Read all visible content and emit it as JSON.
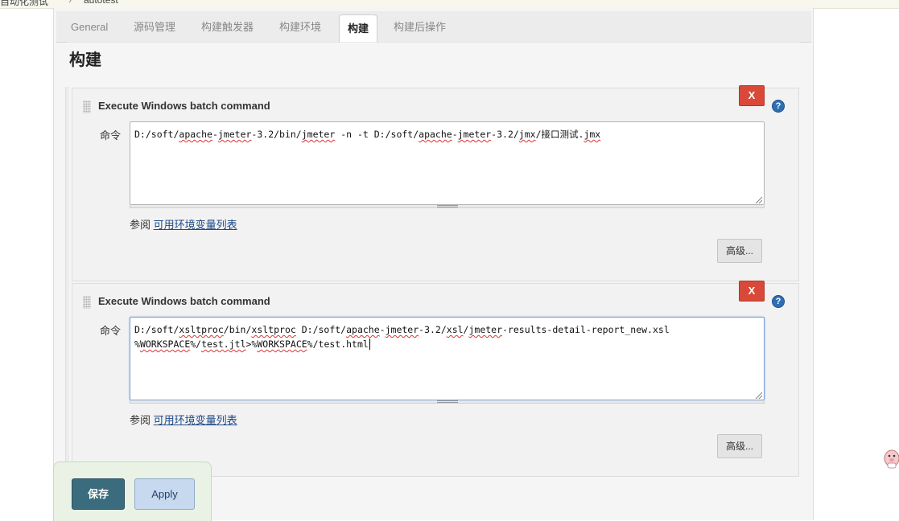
{
  "breadcrumb": {
    "items": [
      "自动化测试",
      "autotest"
    ]
  },
  "tabs": [
    {
      "label": "General",
      "active": false
    },
    {
      "label": "源码管理",
      "active": false
    },
    {
      "label": "构建触发器",
      "active": false
    },
    {
      "label": "构建环境",
      "active": false
    },
    {
      "label": "构建",
      "active": true
    },
    {
      "label": "构建后操作",
      "active": false
    }
  ],
  "section": {
    "title": "构建"
  },
  "steps": [
    {
      "title": "Execute Windows batch command",
      "delete_label": "X",
      "help_label": "?",
      "field_label": "命令",
      "command_lines": [
        "D:/soft/apache-jmeter-3.2/bin/jmeter -n -t D:/soft/apache-jmeter-3.2/jmx/接口测试.jmx"
      ],
      "see_also_prefix": "参阅",
      "see_also_link": "可用环境变量列表",
      "advanced_label": "高级..."
    },
    {
      "title": "Execute Windows batch command",
      "delete_label": "X",
      "help_label": "?",
      "field_label": "命令",
      "command_lines": [
        "D:/soft/xsltproc/bin/xsltproc D:/soft/apache-jmeter-3.2/xsl/jmeter-results-detail-report_new.xsl",
        "%WORKSPACE%/test.jtl>%WORKSPACE%/test.html"
      ],
      "see_also_prefix": "参阅",
      "see_also_link": "可用环境变量列表",
      "advanced_label": "高级..."
    }
  ],
  "footer": {
    "save_label": "保存",
    "apply_label": "Apply"
  },
  "colors": {
    "delete": "#d9493a",
    "save": "#3b6c7d",
    "apply": "#c7d9ee",
    "link": "#204a87"
  }
}
